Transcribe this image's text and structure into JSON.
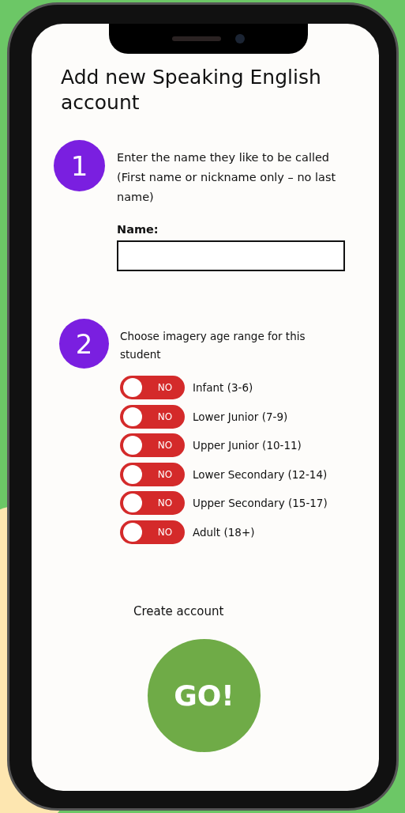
{
  "title": "Add new Speaking English account",
  "step1": {
    "number": "1",
    "instruction": "Enter the name they like to be called (First name or nickname only – no last name)",
    "field_label": "Name:"
  },
  "step2": {
    "number": "2",
    "instruction": "Choose imagery age range for this student",
    "options": [
      {
        "label": "Infant (3-6)",
        "toggle_text": "NO",
        "checked": false
      },
      {
        "label": "Lower Junior (7-9)",
        "toggle_text": "NO",
        "checked": false
      },
      {
        "label": "Upper Junior (10-11)",
        "toggle_text": "NO",
        "checked": false
      },
      {
        "label": "Lower Secondary (12-14)",
        "toggle_text": "NO",
        "checked": false
      },
      {
        "label": "Upper Secondary (15-17)",
        "toggle_text": "NO",
        "checked": false
      },
      {
        "label": "Adult (18+)",
        "toggle_text": "NO",
        "checked": false
      }
    ]
  },
  "create_label": "Create account",
  "go_button": "GO!"
}
